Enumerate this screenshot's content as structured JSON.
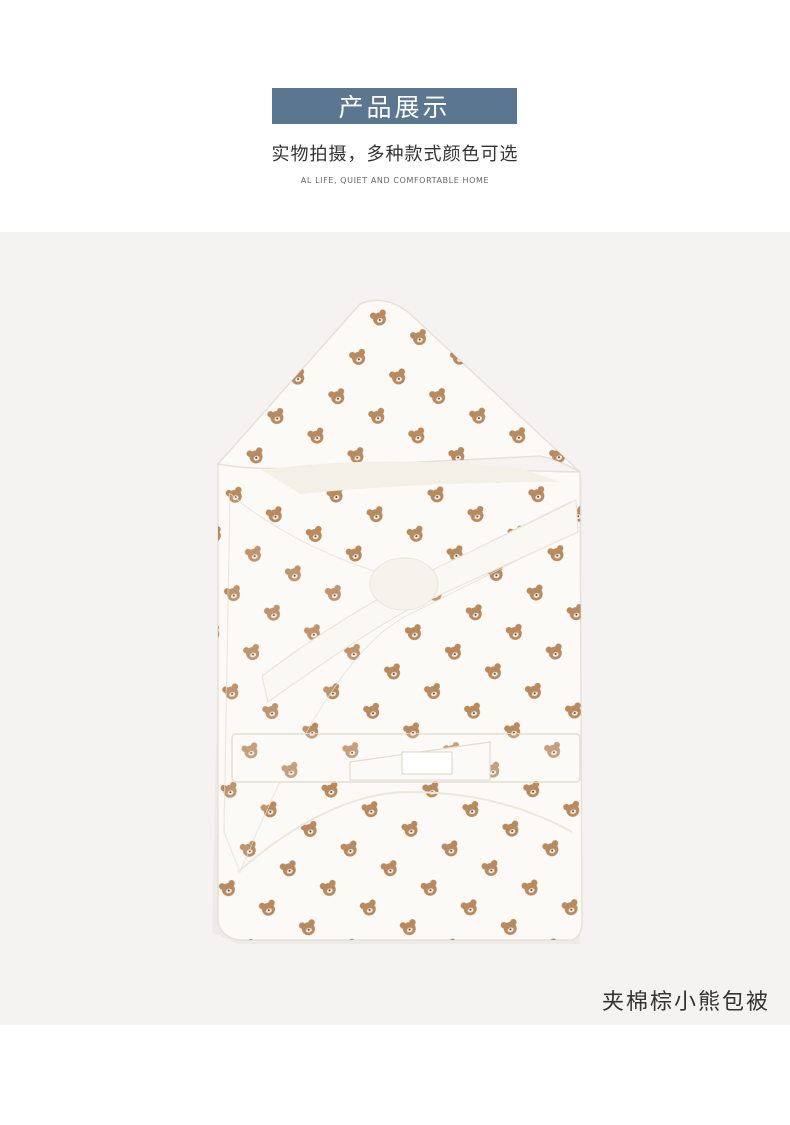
{
  "header": {
    "title": "产品展示",
    "subtitle": "实物拍摄，多种款式颜色可选",
    "caption": "AL LIFE, QUIET AND COMFORTABLE HOME"
  },
  "photo": {
    "product_name": "夹棉棕小熊包被"
  },
  "colors": {
    "banner": "#5b7690",
    "photo_background": "#f4f3f1",
    "fabric": "#fbfaf6",
    "bear": "#b98a5e"
  }
}
